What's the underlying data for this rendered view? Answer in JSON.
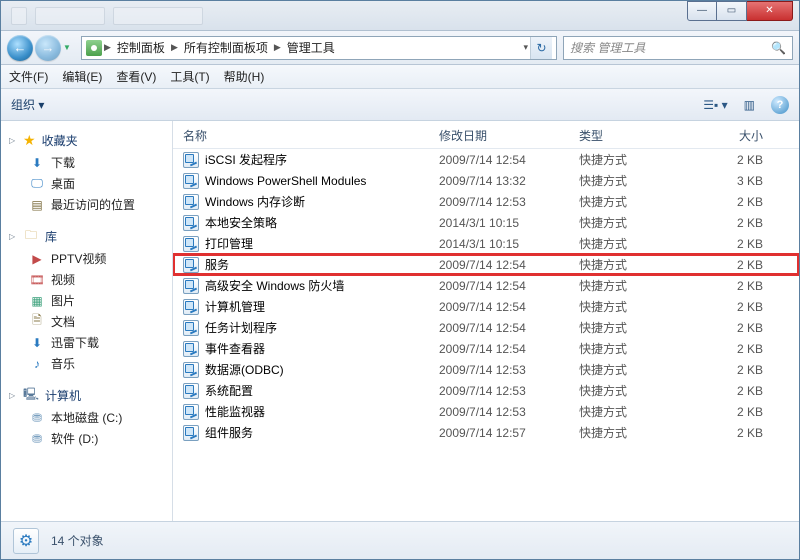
{
  "breadcrumb": [
    "控制面板",
    "所有控制面板项",
    "管理工具"
  ],
  "search_placeholder": "搜索 管理工具",
  "menus": {
    "file": "文件(F)",
    "edit": "编辑(E)",
    "view": "查看(V)",
    "tools": "工具(T)",
    "help": "帮助(H)"
  },
  "toolbar": {
    "organize": "组织"
  },
  "sidebar": {
    "favorites": {
      "label": "收藏夹",
      "items": [
        "下载",
        "桌面",
        "最近访问的位置"
      ]
    },
    "libraries": {
      "label": "库",
      "items": [
        "PPTV视频",
        "视频",
        "图片",
        "文档",
        "迅雷下载",
        "音乐"
      ]
    },
    "computer": {
      "label": "计算机",
      "items": [
        "本地磁盘 (C:)",
        "软件 (D:)"
      ]
    }
  },
  "columns": {
    "name": "名称",
    "date": "修改日期",
    "type": "类型",
    "size": "大小"
  },
  "type_label": "快捷方式",
  "rows": [
    {
      "name": "iSCSI 发起程序",
      "date": "2009/7/14 12:54",
      "size": "2 KB"
    },
    {
      "name": "Windows PowerShell Modules",
      "date": "2009/7/14 13:32",
      "size": "3 KB"
    },
    {
      "name": "Windows 内存诊断",
      "date": "2009/7/14 12:53",
      "size": "2 KB"
    },
    {
      "name": "本地安全策略",
      "date": "2014/3/1 10:15",
      "size": "2 KB"
    },
    {
      "name": "打印管理",
      "date": "2014/3/1 10:15",
      "size": "2 KB"
    },
    {
      "name": "服务",
      "date": "2009/7/14 12:54",
      "size": "2 KB",
      "highlight": true
    },
    {
      "name": "高级安全 Windows 防火墙",
      "date": "2009/7/14 12:54",
      "size": "2 KB"
    },
    {
      "name": "计算机管理",
      "date": "2009/7/14 12:54",
      "size": "2 KB"
    },
    {
      "name": "任务计划程序",
      "date": "2009/7/14 12:54",
      "size": "2 KB"
    },
    {
      "name": "事件查看器",
      "date": "2009/7/14 12:54",
      "size": "2 KB"
    },
    {
      "name": "数据源(ODBC)",
      "date": "2009/7/14 12:53",
      "size": "2 KB"
    },
    {
      "name": "系统配置",
      "date": "2009/7/14 12:53",
      "size": "2 KB"
    },
    {
      "name": "性能监视器",
      "date": "2009/7/14 12:53",
      "size": "2 KB"
    },
    {
      "name": "组件服务",
      "date": "2009/7/14 12:57",
      "size": "2 KB"
    }
  ],
  "status": "14 个对象"
}
